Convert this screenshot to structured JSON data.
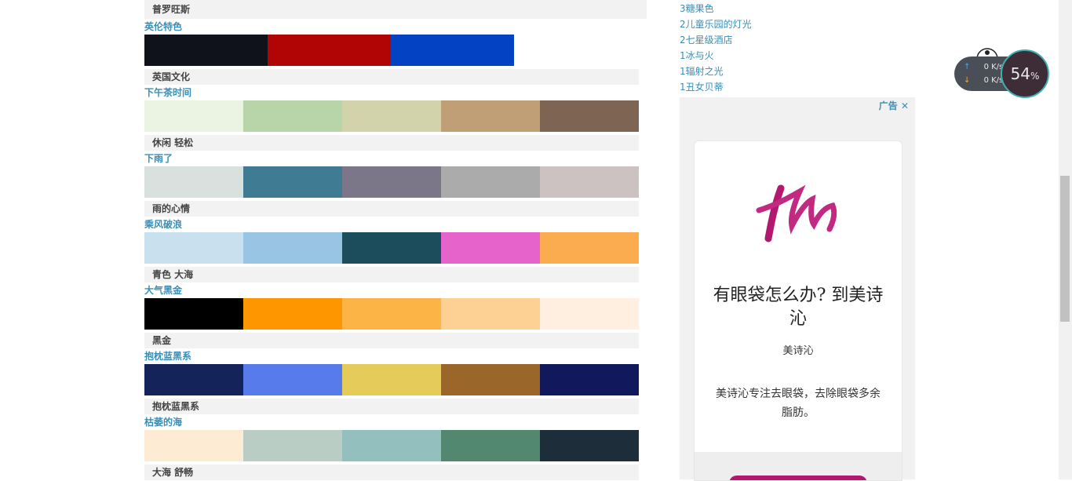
{
  "palettes": [
    {
      "title": "英伦特色",
      "colors": [
        "#0f121b",
        "#b10505",
        "#0342c2"
      ],
      "tag": "英国文化"
    },
    {
      "title": "下午茶时间",
      "colors": [
        "#ebf4e2",
        "#b8d4a9",
        "#d3d3ab",
        "#c19f76",
        "#7d6453"
      ],
      "tag": "休闲 轻松"
    },
    {
      "title": "下雨了",
      "colors": [
        "#d9e1de",
        "#407b94",
        "#7b7789",
        "#ababab",
        "#cbc2c1"
      ],
      "tag": "雨的心情"
    },
    {
      "title": "乘风破浪",
      "colors": [
        "#c9e0ef",
        "#99c5e5",
        "#1b4d5c",
        "#e563cb",
        "#fbac4e"
      ],
      "tag": "青色 大海"
    },
    {
      "title": "大气黑金",
      "colors": [
        "#000000",
        "#fe9600",
        "#fdb446",
        "#fdd094",
        "#feefe0"
      ],
      "tag": "黑金"
    },
    {
      "title": "抱枕蓝黑系",
      "colors": [
        "#14245a",
        "#577bea",
        "#e5cc5a",
        "#9a662a",
        "#11195c"
      ],
      "tag": "抱枕蓝黑系"
    },
    {
      "title": "枯萎的海",
      "colors": [
        "#fdebd3",
        "#bacdc4",
        "#93bfbe",
        "#528870",
        "#1d2e3a"
      ],
      "tag": "大海 舒畅"
    }
  ],
  "top_tag": "普罗旺斯",
  "rank_list": [
    {
      "num": "3",
      "label": "糖果色"
    },
    {
      "num": "2",
      "label": "儿童乐园的灯光"
    },
    {
      "num": "2",
      "label": "七星级酒店"
    },
    {
      "num": "1",
      "label": "冰与火"
    },
    {
      "num": "1",
      "label": "辐射之光"
    },
    {
      "num": "1",
      "label": "丑女贝蒂"
    }
  ],
  "ad": {
    "label": "广告",
    "close": "✕",
    "headline": "有眼袋怎么办? 到美诗沁",
    "brand": "美诗沁",
    "desc": "美诗沁专注去眼袋，去除眼袋多余脂肪。",
    "brand_color": "#b2186f"
  },
  "widget": {
    "upload": "0 K/s",
    "download": "0 K/s",
    "percent": "54",
    "percent_sign": "%"
  }
}
